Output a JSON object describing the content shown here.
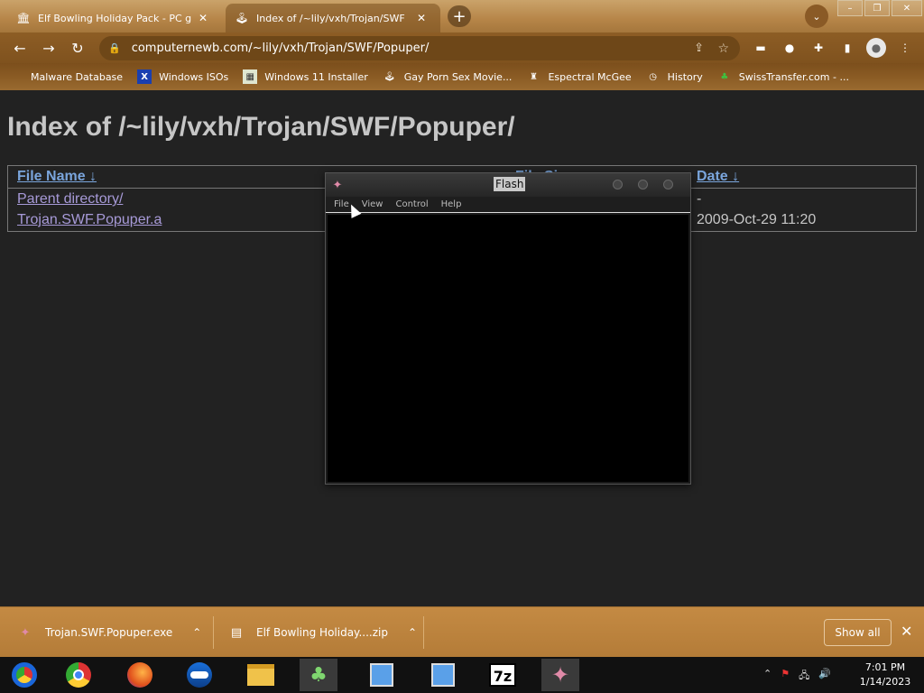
{
  "tabs": [
    {
      "title": "Elf Bowling Holiday Pack - PC gam",
      "active": false
    },
    {
      "title": "Index of /~lily/vxh/Trojan/SWF",
      "active": true
    }
  ],
  "window_controls": {
    "minimize": "–",
    "restore": "❐",
    "close": "✕"
  },
  "toolbar": {
    "url": "computernewb.com/~lily/vxh/Trojan/SWF/Popuper/"
  },
  "bookmarks": [
    {
      "label": "Malware Database",
      "icon": "blank"
    },
    {
      "label": "Windows ISOs",
      "icon": "x-logo"
    },
    {
      "label": "Windows 11 Installer",
      "icon": "image-icon"
    },
    {
      "label": "Gay Porn Sex Movie...",
      "icon": "joystick-icon"
    },
    {
      "label": "Espectral McGee",
      "icon": "figure-icon"
    },
    {
      "label": "History",
      "icon": "history-icon"
    },
    {
      "label": "SwissTransfer.com - ...",
      "icon": "swiss-icon"
    }
  ],
  "page": {
    "heading": "Index of /~lily/vxh/Trojan/SWF/Popuper/",
    "columns": {
      "name": "File Name  ↓",
      "size": "File Size",
      "date": "Date  ↓"
    },
    "rows": [
      {
        "name": "Parent directory/",
        "date": "-"
      },
      {
        "name": "Trojan.SWF.Popuper.a",
        "date": "2009-Oct-29 11:20"
      }
    ]
  },
  "flash_window": {
    "title": "Flash",
    "menu": [
      "File",
      "View",
      "Control",
      "Help"
    ]
  },
  "downloads": {
    "items": [
      {
        "name": "Trojan.SWF.Popuper.exe"
      },
      {
        "name": "Elf Bowling Holiday....zip"
      }
    ],
    "show_all": "Show all"
  },
  "taskbar": {
    "time": "7:01 PM",
    "date": "1/14/2023",
    "apps": [
      "chrome-old-icon",
      "chrome-icon",
      "firefox-icon",
      "opera-icon",
      "file-explorer-icon",
      "msn-icon",
      "setup-icon",
      "setup-icon",
      "7zip-icon",
      "flash-icon"
    ]
  },
  "colors": {
    "frame": "#b68548",
    "page_bg": "#222222",
    "link": "#7aa5dc",
    "visited_link": "#a79ad8"
  }
}
